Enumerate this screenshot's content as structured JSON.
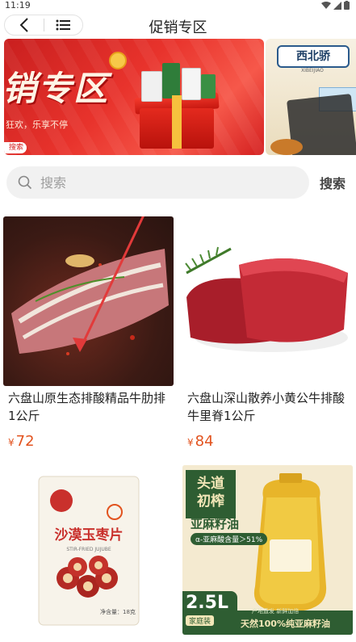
{
  "status": {
    "time": "11:19"
  },
  "nav": {
    "title": "促销专区"
  },
  "banner": {
    "headline": "销专区",
    "subline": "狂欢，乐享不停",
    "tag": "搜索"
  },
  "banner2": {
    "brand": "西北骄",
    "brand_sub": "XIBEIJIAO"
  },
  "search": {
    "placeholder": "搜索",
    "button_label": "搜索"
  },
  "products": [
    {
      "name": "六盘山原生态排酸精品牛肋排1公斤",
      "currency": "¥",
      "price": "72"
    },
    {
      "name": "六盘山深山散养小黄公牛排酸牛里脊1公斤",
      "currency": "¥",
      "price": "84"
    },
    {
      "name": "",
      "currency": "",
      "price": ""
    },
    {
      "name": "",
      "currency": "",
      "price": ""
    }
  ],
  "jujube_pack": {
    "brand": "沙漠玉枣片",
    "sub": "STIR-FRIED JUJUBE",
    "weight": "净含量：18克"
  },
  "oil_pack": {
    "title_line1": "头道",
    "title_line2": "初榨",
    "name": "亚麻籽油",
    "pill": "α-亚麻酸含量＞51%",
    "size": "2.5L",
    "size_tag": "家庭装",
    "sub": "产地直发 新鲜加倍",
    "bottom": "天然100%纯亚麻籽油"
  },
  "colors": {
    "price": "#e2531f",
    "accent_red": "#e8332c",
    "oil_green": "#2e5d32"
  }
}
